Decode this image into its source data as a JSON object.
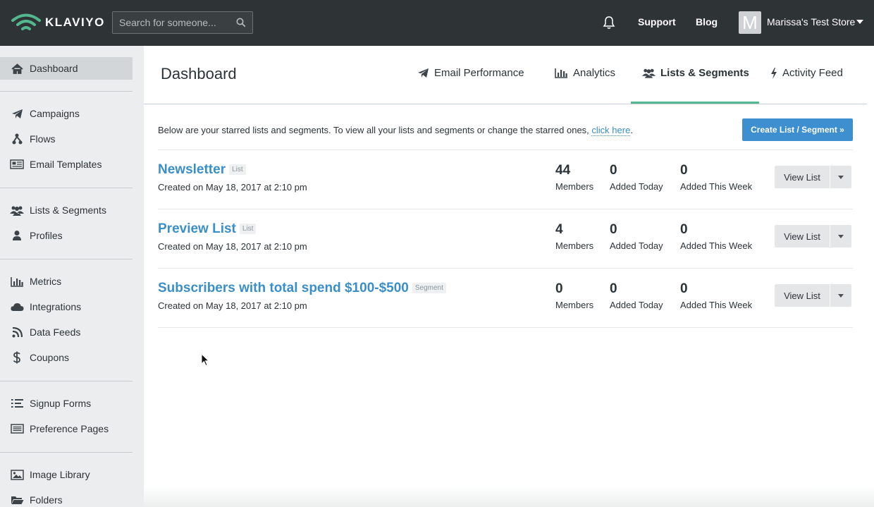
{
  "header": {
    "logo_text": "KLAVIYO",
    "search_placeholder": "Search for someone...",
    "support": "Support",
    "blog": "Blog",
    "avatar_letter": "M",
    "store_name": "Marissa's Test Store"
  },
  "sidebar": {
    "items": [
      {
        "label": "Dashboard",
        "icon": "home-icon"
      },
      {
        "label": "Campaigns",
        "icon": "paper-plane-icon"
      },
      {
        "label": "Flows",
        "icon": "flow-icon"
      },
      {
        "label": "Email Templates",
        "icon": "newspaper-icon"
      },
      {
        "label": "Lists & Segments",
        "icon": "users-icon"
      },
      {
        "label": "Profiles",
        "icon": "user-icon"
      },
      {
        "label": "Metrics",
        "icon": "bar-chart-icon"
      },
      {
        "label": "Integrations",
        "icon": "cloud-icon"
      },
      {
        "label": "Data Feeds",
        "icon": "rss-icon"
      },
      {
        "label": "Coupons",
        "icon": "dollar-icon"
      },
      {
        "label": "Signup Forms",
        "icon": "list-icon"
      },
      {
        "label": "Preference Pages",
        "icon": "list-alt-icon"
      },
      {
        "label": "Image Library",
        "icon": "image-icon"
      },
      {
        "label": "Folders",
        "icon": "folder-icon"
      }
    ]
  },
  "main": {
    "title": "Dashboard",
    "tabs": [
      {
        "label": "Email Performance",
        "icon": "paper-plane-icon"
      },
      {
        "label": "Analytics",
        "icon": "bar-chart-icon"
      },
      {
        "label": "Lists & Segments",
        "icon": "users-icon",
        "active": true
      },
      {
        "label": "Activity Feed",
        "icon": "bolt-icon"
      }
    ],
    "intro_text": "Below are your starred lists and segments. To view all your lists and segments or change the starred ones, ",
    "intro_link": "click here",
    "intro_end": ".",
    "create_button": "Create List / Segment »",
    "stat_labels": {
      "members": "Members",
      "today": "Added Today",
      "week": "Added This Week"
    },
    "view_button": "View List",
    "rows": [
      {
        "name": "Newsletter",
        "type": "List",
        "created": "Created on May 18, 2017 at 2:10 pm",
        "members": "44",
        "today": "0",
        "week": "0"
      },
      {
        "name": "Preview List",
        "type": "List",
        "created": "Created on May 18, 2017 at 2:10 pm",
        "members": "4",
        "today": "0",
        "week": "0"
      },
      {
        "name": "Subscribers with total spend $100-$500",
        "type": "Segment",
        "created": "Created on May 18, 2017 at 2:10 pm",
        "members": "0",
        "today": "0",
        "week": "0"
      }
    ]
  },
  "colors": {
    "accent": "#3a8fc8",
    "topbar": "#2e3336",
    "tab_underline": "#54b88e",
    "primary_button": "#3d8fd0"
  }
}
